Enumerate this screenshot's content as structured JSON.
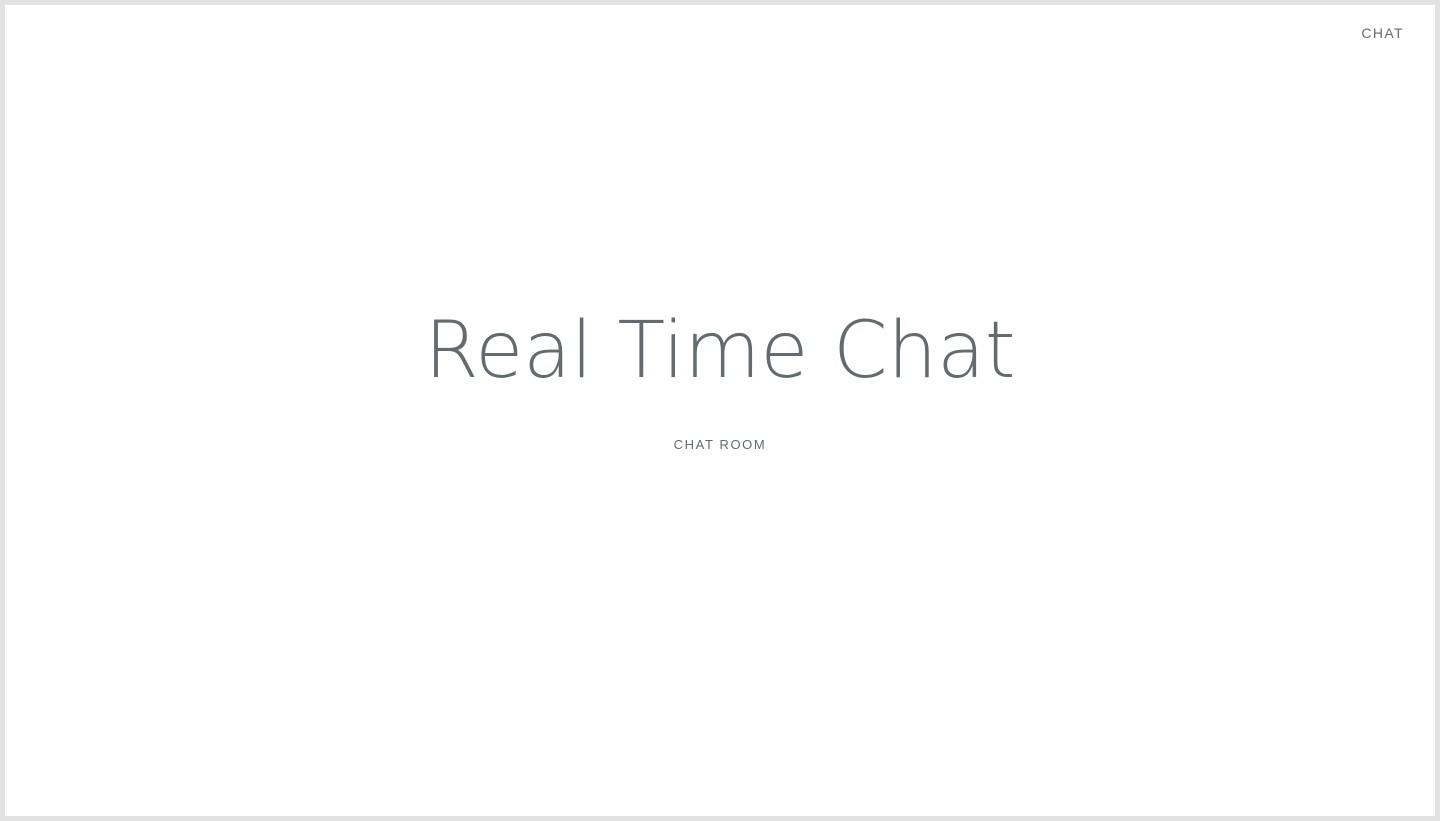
{
  "header": {
    "chat_link": "CHAT"
  },
  "main": {
    "title": "Real Time Chat",
    "links": [
      {
        "label": "CHAT ROOM"
      }
    ]
  },
  "colors": {
    "background": "#ffffff",
    "frame": "#e2e2e2",
    "text": "#636b6f"
  }
}
